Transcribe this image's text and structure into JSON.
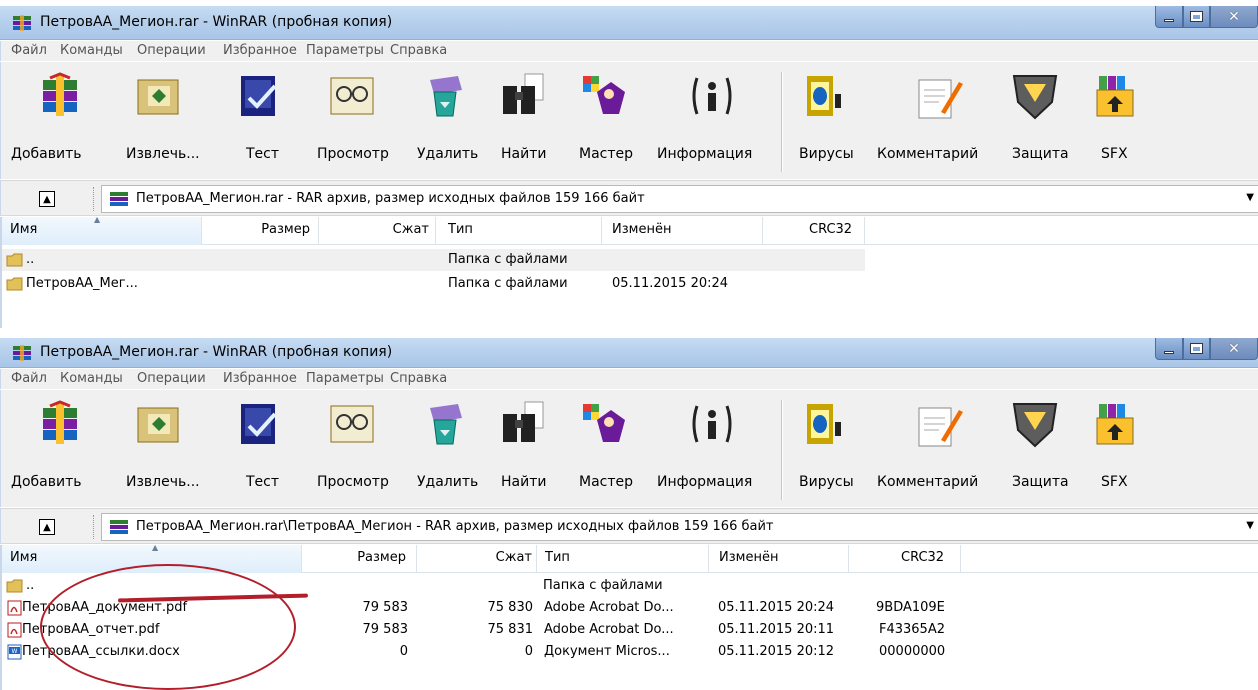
{
  "windows": [
    {
      "title": "ПетровАА_Мегион.rar - WinRAR (пробная копия)",
      "menu": [
        "Файл",
        "Команды",
        "Операции",
        "Избранное",
        "Параметры",
        "Справка"
      ],
      "toolbar": [
        "Добавить",
        "Извлечь...",
        "Тест",
        "Просмотр",
        "Удалить",
        "Найти",
        "Мастер",
        "Информация",
        "Вирусы",
        "Комментарий",
        "Защита",
        "SFX"
      ],
      "address": "ПетровАА_Мегион.rar - RAR архив, размер исходных файлов 159 166 байт",
      "columns": [
        "Имя",
        "Размер",
        "Сжат",
        "Тип",
        "Изменён",
        "CRC32"
      ],
      "rows": [
        {
          "name": "..",
          "size": "",
          "packed": "",
          "type": "Папка с файлами",
          "modified": "",
          "crc": ""
        },
        {
          "name": "ПетровАА_Мег...",
          "size": "",
          "packed": "",
          "type": "Папка с файлами",
          "modified": "05.11.2015 20:24",
          "crc": ""
        }
      ]
    },
    {
      "title": "ПетровАА_Мегион.rar - WinRAR (пробная копия)",
      "menu": [
        "Файл",
        "Команды",
        "Операции",
        "Избранное",
        "Параметры",
        "Справка"
      ],
      "toolbar": [
        "Добавить",
        "Извлечь...",
        "Тест",
        "Просмотр",
        "Удалить",
        "Найти",
        "Мастер",
        "Информация",
        "Вирусы",
        "Комментарий",
        "Защита",
        "SFX"
      ],
      "address": "ПетровАА_Мегион.rar\\ПетровАА_Мегион - RAR архив, размер исходных файлов 159 166 байт",
      "columns": [
        "Имя",
        "Размер",
        "Сжат",
        "Тип",
        "Изменён",
        "CRC32"
      ],
      "rows": [
        {
          "name": "..",
          "size": "",
          "packed": "",
          "type": "Папка с файлами",
          "modified": "",
          "crc": ""
        },
        {
          "name": "ПетровАА_документ.pdf",
          "size": "79 583",
          "packed": "75 830",
          "type": "Adobe Acrobat Do...",
          "modified": "05.11.2015 20:24",
          "crc": "9BDA109E"
        },
        {
          "name": "ПетровАА_отчет.pdf",
          "size": "79 583",
          "packed": "75 831",
          "type": "Adobe Acrobat Do...",
          "modified": "05.11.2015 20:11",
          "crc": "F43365A2"
        },
        {
          "name": "ПетровАА_ссылки.docx",
          "size": "0",
          "packed": "0",
          "type": "Документ Micros...",
          "modified": "05.11.2015 20:12",
          "crc": "00000000"
        }
      ]
    }
  ],
  "icons": {
    "toolbar": [
      "add-icon",
      "extract-icon",
      "test-icon",
      "view-icon",
      "delete-icon",
      "find-icon",
      "wizard-icon",
      "info-icon",
      "virus-scan-icon",
      "comment-icon",
      "protect-icon",
      "sfx-icon"
    ],
    "window_buttons": [
      "minimize-icon",
      "maximize-icon",
      "close-icon"
    ],
    "up_button": "up-arrow-icon",
    "file_types": {
      "folder": "folder-icon",
      "pdf": "pdf-icon",
      "docx": "word-icon"
    }
  },
  "colors": {
    "titlebar": "#b7d0ec",
    "annotation": "#b21f2a",
    "toolbar_bg": "#f0f0f0"
  }
}
